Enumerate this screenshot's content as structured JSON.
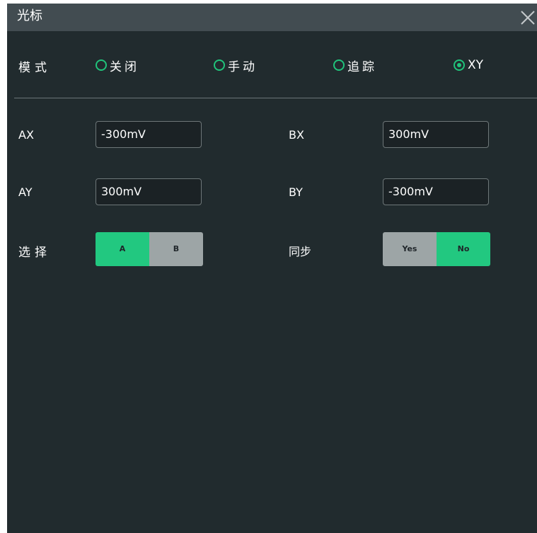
{
  "window": {
    "title": "光标"
  },
  "mode": {
    "label": "模式",
    "options": [
      {
        "label": "关闭",
        "selected": false
      },
      {
        "label": "手动",
        "selected": false
      },
      {
        "label": "追踪",
        "selected": false
      },
      {
        "label": "XY",
        "selected": true
      }
    ]
  },
  "fields": {
    "ax": {
      "label": "AX",
      "value": "-300mV"
    },
    "bx": {
      "label": "BX",
      "value": "300mV"
    },
    "ay": {
      "label": "AY",
      "value": "300mV"
    },
    "by": {
      "label": "BY",
      "value": "-300mV"
    }
  },
  "select": {
    "label": "选择",
    "options": [
      "A",
      "B"
    ],
    "active": "A"
  },
  "sync": {
    "label": "同步",
    "options": [
      "Yes",
      "No"
    ],
    "active": "No"
  },
  "colors": {
    "accent": "#20c47b",
    "panel_bg": "#212b2e",
    "titlebar_bg": "#424c51",
    "inactive_segment": "#9da5a6"
  }
}
